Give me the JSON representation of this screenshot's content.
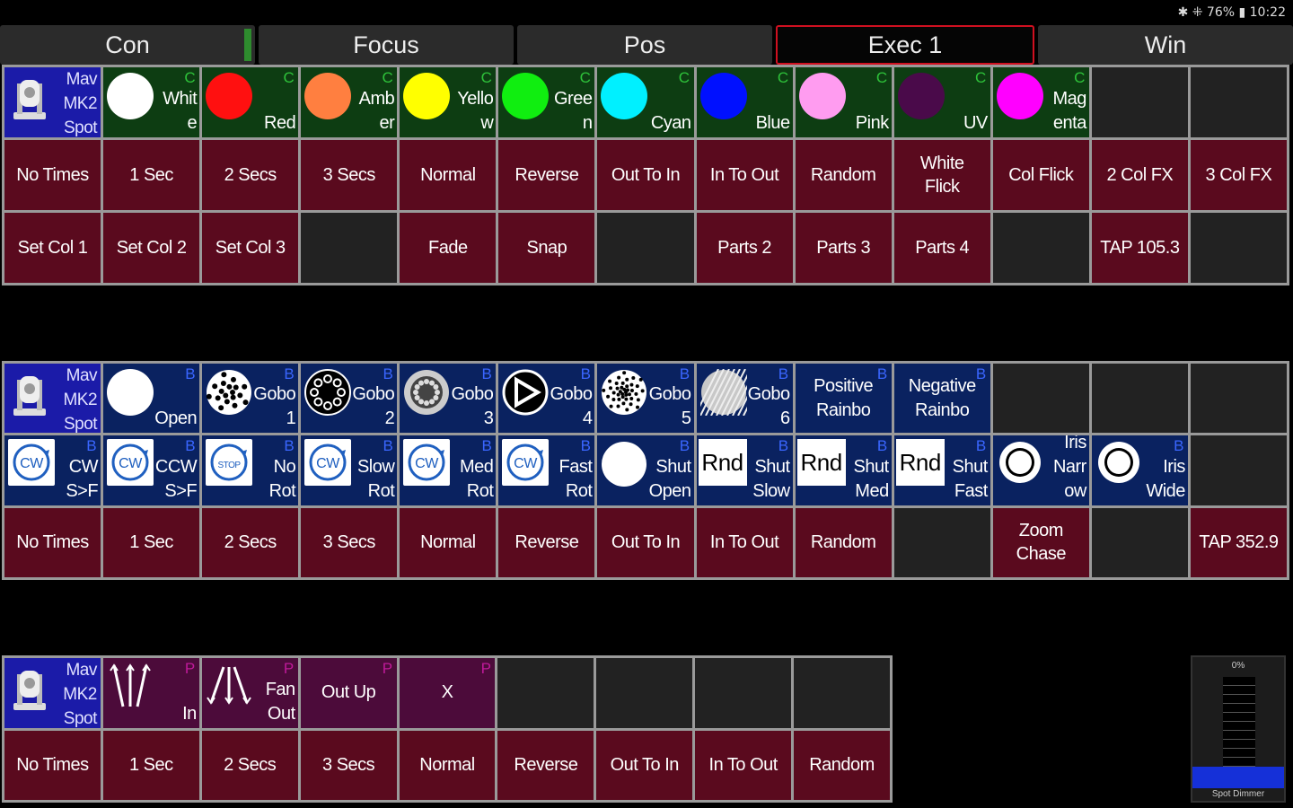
{
  "status_bar": {
    "text": "✱ ⁜ 76% ▮ 10:22"
  },
  "tabs": [
    {
      "label": "Con",
      "active": false
    },
    {
      "label": "Focus",
      "active": false
    },
    {
      "label": "Pos",
      "active": false
    },
    {
      "label": "Exec 1",
      "active": true
    },
    {
      "label": "Win",
      "active": false
    }
  ],
  "fixture": {
    "line1": "Mav",
    "line2": "MK2",
    "line3": "Spot"
  },
  "colours": [
    {
      "label": "Whit\ne",
      "color": "#ffffff",
      "tag": "C"
    },
    {
      "label": "Red",
      "color": "#ff1010",
      "tag": "C"
    },
    {
      "label": "Amb\ner",
      "color": "#ff7f40",
      "tag": "C"
    },
    {
      "label": "Yello\nw",
      "color": "#ffff00",
      "tag": "C"
    },
    {
      "label": "Gree\nn",
      "color": "#10ee10",
      "tag": "C"
    },
    {
      "label": "Cyan",
      "color": "#00f0ff",
      "tag": "C"
    },
    {
      "label": "Blue",
      "color": "#0010ff",
      "tag": "C"
    },
    {
      "label": "Pink",
      "color": "#ff9cf0",
      "tag": "C"
    },
    {
      "label": "UV",
      "color": "#4a0a4a",
      "tag": "C"
    },
    {
      "label": "Mag\nenta",
      "color": "#ff00ff",
      "tag": "C"
    }
  ],
  "colour_fx_row": [
    "No Times",
    "1 Sec",
    "2 Secs",
    "3 Secs",
    "Normal",
    "Reverse",
    "Out To In",
    "In To Out",
    "Random",
    "White\nFlick",
    "Col Flick",
    "2 Col FX",
    "3 Col FX"
  ],
  "colour_set_row": [
    "Set Col 1",
    "Set Col 2",
    "Set Col 3",
    "",
    "Fade",
    "Snap",
    "",
    "Parts 2",
    "Parts 3",
    "Parts 4",
    "",
    "TAP 105.3",
    ""
  ],
  "gobos": [
    {
      "label": "Open",
      "tag": "B"
    },
    {
      "label": "Gobo\n1",
      "tag": "B"
    },
    {
      "label": "Gobo\n2",
      "tag": "B"
    },
    {
      "label": "Gobo\n3",
      "tag": "B"
    },
    {
      "label": "Gobo\n4",
      "tag": "B"
    },
    {
      "label": "Gobo\n5",
      "tag": "B"
    },
    {
      "label": "Gobo\n6",
      "tag": "B"
    },
    {
      "label": "Positive\nRainbo",
      "tag": "B"
    },
    {
      "label": "Negative\nRainbo",
      "tag": "B"
    }
  ],
  "beam2": [
    {
      "label": "CW\nS>F",
      "icon": "CW",
      "tag": "B"
    },
    {
      "label": "CCW\nS>F",
      "icon": "CW",
      "tag": "B"
    },
    {
      "label": "No\nRot",
      "icon": "STOP",
      "tag": "B"
    },
    {
      "label": "Slow\nRot",
      "icon": "CW",
      "tag": "B"
    },
    {
      "label": "Med\nRot",
      "icon": "CW",
      "tag": "B"
    },
    {
      "label": "Fast\nRot",
      "icon": "CW",
      "tag": "B"
    },
    {
      "label": "Shut\nOpen",
      "tag": "B"
    },
    {
      "label": "Shut\nSlow",
      "icon": "Rnd",
      "tag": "B"
    },
    {
      "label": "Shut\nMed",
      "icon": "Rnd",
      "tag": "B"
    },
    {
      "label": "Shut\nFast",
      "icon": "Rnd",
      "tag": "B"
    },
    {
      "label": "Iris\nNarr\now",
      "tag": ""
    },
    {
      "label": "Iris\nWide",
      "tag": "B"
    }
  ],
  "beam_fx_row": [
    "No Times",
    "1 Sec",
    "2 Secs",
    "3 Secs",
    "Normal",
    "Reverse",
    "Out To In",
    "In To Out",
    "Random",
    "",
    "Zoom\nChase",
    "",
    "TAP 352.9"
  ],
  "positions": [
    {
      "label": "In",
      "tag": "P"
    },
    {
      "label": "Fan\nOut",
      "tag": "P"
    },
    {
      "label": "Out Up",
      "tag": "P"
    },
    {
      "label": "X",
      "tag": "P"
    }
  ],
  "pos_fx_row": [
    "No Times",
    "1 Sec",
    "2 Secs",
    "3 Secs",
    "Normal",
    "Reverse",
    "Out To In",
    "In To Out",
    "Random"
  ],
  "fader": {
    "value": "0%",
    "name": "Spot Dimmer",
    "level": 0
  }
}
